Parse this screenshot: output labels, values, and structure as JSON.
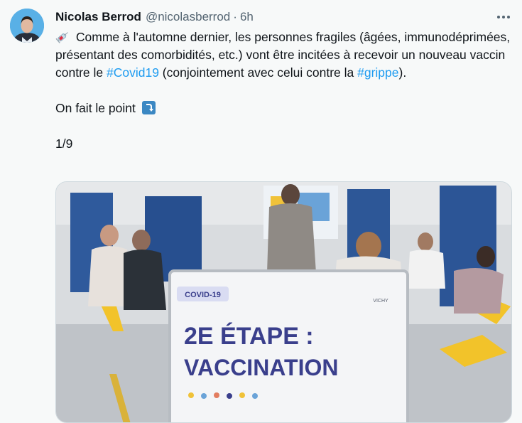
{
  "author": {
    "name": "Nicolas Berrod",
    "handle": "@nicolasberrod",
    "separator": "·",
    "time": "6h"
  },
  "tweet": {
    "emoji_start": "syringe-icon",
    "line1": "Comme à l'automne dernier, les personnes fragiles (âgées, immunodéprimées, présentant des comorbidités, etc.) vont être incitées à recevoir un nouveau vaccin contre le ",
    "hashtag1": "#Covid19",
    "line1_cont": " (conjointement avec celui contre la ",
    "hashtag2": "#grippe",
    "line1_end": ").",
    "line2": "On fait le point",
    "emoji_end": "arrow-curve-down-icon",
    "line3": "1/9"
  },
  "media": {
    "sign_tag": "COVID-19",
    "sign_logo": "VICHY",
    "sign_line1": "2E ÉTAPE :",
    "sign_line2": "VACCINATION"
  },
  "colors": {
    "background": "#f7f9f9",
    "link": "#1d9bf0",
    "secondary_text": "#536471",
    "sign_text": "#3a3f8c"
  }
}
